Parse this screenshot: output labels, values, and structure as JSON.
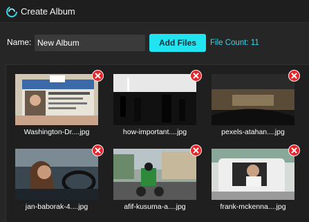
{
  "window": {
    "title": "Create Album",
    "app_icon": "swirl-logo-icon"
  },
  "form": {
    "name_label": "Name:",
    "name_value": "New Album",
    "add_files_label": "Add Files",
    "file_count": "File Count: 11"
  },
  "colors": {
    "accent": "#22e3f0",
    "remove": "#e5262a",
    "background": "#1f1f1f"
  },
  "gallery": {
    "items": [
      {
        "caption": "Washington-Dr....jpg",
        "remove_icon": "close-icon"
      },
      {
        "caption": "how-important....jpg",
        "remove_icon": "close-icon"
      },
      {
        "caption": "pexels-atahan....jpg",
        "remove_icon": "close-icon"
      },
      {
        "caption": "jan-baborak-4....jpg",
        "remove_icon": "close-icon"
      },
      {
        "caption": "afif-kusuma-a....jpg",
        "remove_icon": "close-icon"
      },
      {
        "caption": "frank-mckenna....jpg",
        "remove_icon": "close-icon"
      }
    ]
  }
}
